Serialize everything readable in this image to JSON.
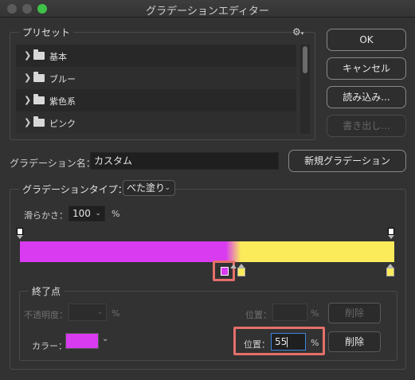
{
  "window": {
    "title": "グラデーションエディター"
  },
  "presets": {
    "label": "プリセット",
    "items": [
      {
        "name": "基本"
      },
      {
        "name": "ブルー"
      },
      {
        "name": "紫色系"
      },
      {
        "name": "ピンク"
      }
    ]
  },
  "buttons": {
    "ok": "OK",
    "cancel": "キャンセル",
    "load": "読み込み...",
    "export": "書き出し...",
    "new_gradient": "新規グラデーション"
  },
  "name_field": {
    "label": "グラデーション名：",
    "value": "カスタム"
  },
  "gradient_type": {
    "label": "グラデーションタイプ：",
    "value": "べた塗り"
  },
  "smoothness": {
    "label": "滑らかさ：",
    "value": "100",
    "unit": "%"
  },
  "gradient": {
    "color_a": "#d93bf0",
    "color_b": "#fbeb5b",
    "midpoint_percent": 55
  },
  "stops": {
    "label": "終了点",
    "opacity_label": "不透明度：",
    "opacity_value": "",
    "opacity_unit": "%",
    "opacity_location_label": "位置：",
    "opacity_location_value": "",
    "opacity_location_unit": "%",
    "opacity_delete": "削除",
    "color_label": "カラー：",
    "color_value": "#d93bf0",
    "color_location_label": "位置：",
    "color_location_value": "55",
    "color_location_unit": "%",
    "color_delete": "削除"
  },
  "colors": {
    "highlight": "#e56f6a",
    "magenta": "#d93bf0",
    "yellow": "#fbeb5b"
  }
}
